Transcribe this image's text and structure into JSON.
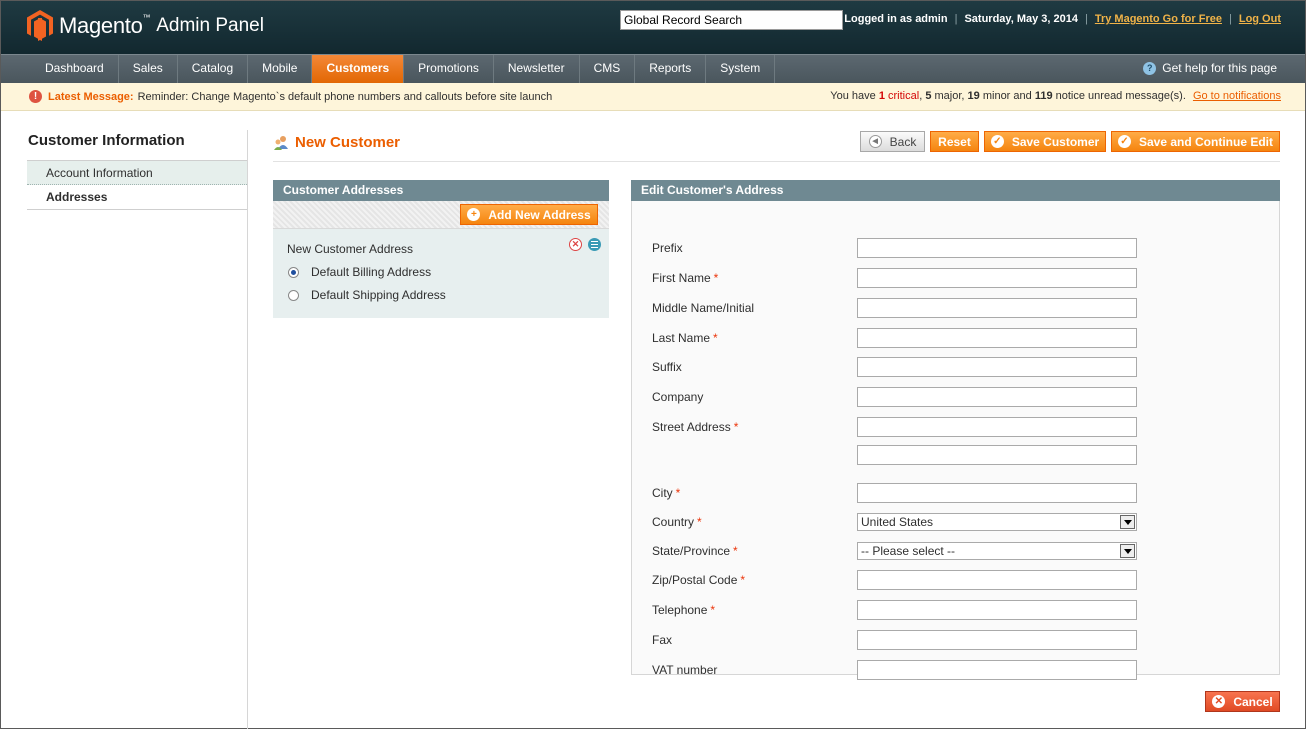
{
  "header": {
    "logo_text": "Magento",
    "logo_tm": "™",
    "logo_sub": "Admin Panel",
    "search_value": "Global Record Search",
    "logged_in": "Logged in as admin",
    "date": "Saturday, May 3, 2014",
    "try_link": "Try Magento Go for Free",
    "logout_link": "Log Out",
    "separator": "|"
  },
  "nav": {
    "items": [
      "Dashboard",
      "Sales",
      "Catalog",
      "Mobile",
      "Customers",
      "Promotions",
      "Newsletter",
      "CMS",
      "Reports",
      "System"
    ],
    "active_index": 4,
    "help_text": "Get help for this page",
    "help_icon_glyph": "?"
  },
  "notice": {
    "icon_glyph": "!",
    "title": "Latest Message:",
    "message": "Reminder: Change Magento`s default phone numbers and callouts before site launch",
    "summary_prefix": "You have",
    "critical_count": "1",
    "critical_label": "critical",
    "major_count": "5",
    "major_label": "major",
    "minor_count": "19",
    "minor_label": "minor and",
    "notice_count": "119",
    "notice_label": "notice unread message(s).",
    "link": "Go to notifications"
  },
  "sidebar": {
    "title": "Customer Information",
    "tabs": [
      "Account Information",
      "Addresses"
    ]
  },
  "page": {
    "title": "New Customer"
  },
  "buttons": {
    "back": "Back",
    "reset": "Reset",
    "save": "Save Customer",
    "save_continue": "Save and Continue Edit",
    "add_address": "Add New Address",
    "cancel": "Cancel"
  },
  "addresses": {
    "panel_title": "Customer Addresses",
    "item_title": "New Customer Address",
    "billing": "Default Billing Address",
    "shipping": "Default Shipping Address"
  },
  "edit_address": {
    "panel_title": "Edit Customer's Address",
    "required_mark": "*",
    "fields": {
      "prefix": "Prefix",
      "first_name": "First Name",
      "middle_name": "Middle Name/Initial",
      "last_name": "Last Name",
      "suffix": "Suffix",
      "company": "Company",
      "street": "Street Address",
      "city": "City",
      "country": "Country",
      "state": "State/Province",
      "zip": "Zip/Postal Code",
      "telephone": "Telephone",
      "fax": "Fax",
      "vat": "VAT number"
    },
    "country_value": "United States",
    "state_value": "-- Please select --"
  },
  "colors": {
    "accent": "#eb5e00",
    "header_bg": "#1f3a42",
    "panel_head": "#6f8992"
  }
}
